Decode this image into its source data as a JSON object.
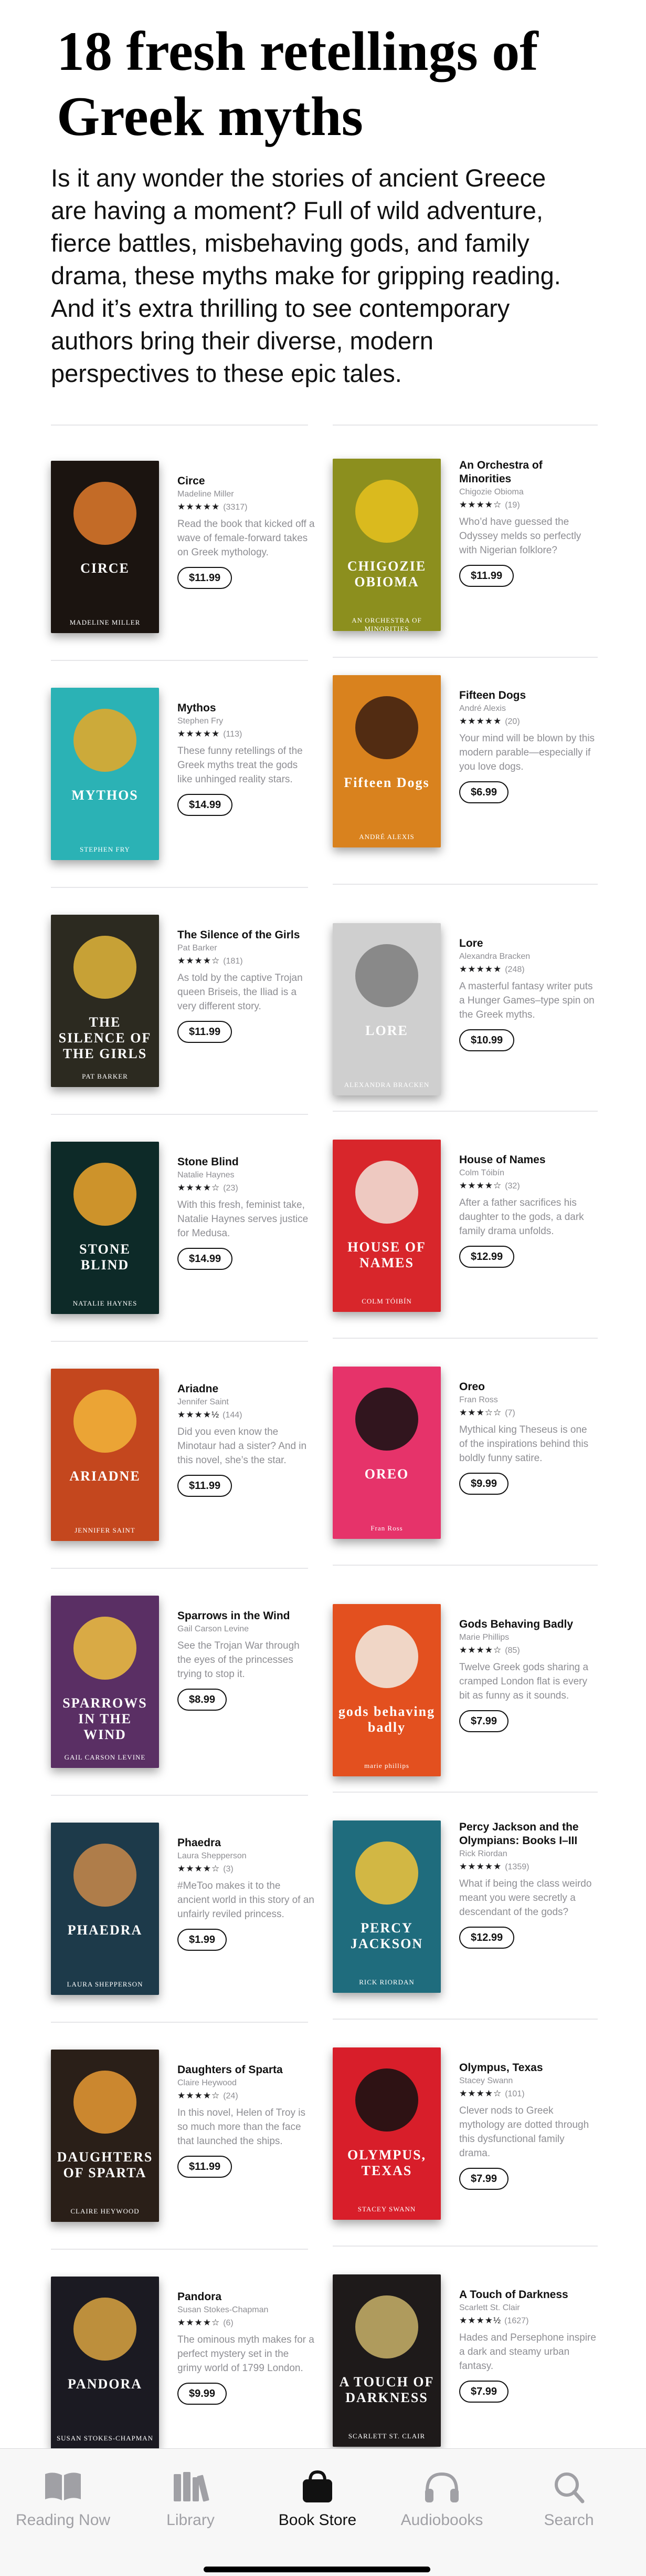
{
  "title": "18 fresh retellings of Greek myths",
  "intro": "Is it any wonder the stories of ancient Greece are having a moment? Full of wild adventure, fierce battles, misbehaving gods, and family drama, these myths make for gripping reading. And it’s extra thrilling to see contemporary authors bring their diverse, modern perspectives to these epic tales.",
  "books": [
    {
      "title": "Circe",
      "author": "Madeline Miller",
      "stars": "★★★★★",
      "count": "(3317)",
      "desc": "Read the book that kicked off a wave of female-forward takes on Greek mythology.",
      "price": "$11.99",
      "cover": {
        "line1": "CIRCE",
        "line2": "MADELINE MILLER",
        "bg": "#1b1410",
        "accent": "#e07a2c"
      }
    },
    {
      "title": "An Orchestra of Minorities",
      "author": "Chigozie Obioma",
      "stars": "★★★★☆",
      "count": "(19)",
      "desc": "Who’d have guessed the Odyssey melds so perfectly with Nigerian folklore?",
      "price": "$11.99",
      "cover": {
        "line1": "CHIGOZIE OBIOMA",
        "line2": "AN ORCHESTRA OF MINORITIES",
        "bg": "#8c8f1e",
        "accent": "#e8c21e"
      }
    },
    {
      "title": "Mythos",
      "author": "Stephen Fry",
      "stars": "★★★★★",
      "count": "(113)",
      "desc": "These funny retellings of the Greek myths treat the gods like unhinged reality stars.",
      "price": "$14.99",
      "cover": {
        "line1": "MYTHOS",
        "line2": "STEPHEN FRY",
        "bg": "#2bb2b5",
        "accent": "#e9a825"
      }
    },
    {
      "title": "Fifteen Dogs",
      "author": "André Alexis",
      "stars": "★★★★★",
      "count": "(20)",
      "desc": "Your mind will be blown by this modern parable—especially if you love dogs.",
      "price": "$6.99",
      "cover": {
        "line1": "Fifteen Dogs",
        "line2": "ANDRÉ ALEXIS",
        "bg": "#d9821e",
        "accent": "#3a1d10"
      }
    },
    {
      "title": "The Silence of the Girls",
      "author": "Pat Barker",
      "stars": "★★★★☆",
      "count": "(181)",
      "desc": "As told by the captive Trojan queen Briseis, the Iliad is a very different story.",
      "price": "$11.99",
      "cover": {
        "line1": "THE SILENCE OF THE GIRLS",
        "line2": "PAT BARKER",
        "bg": "#2c2a20",
        "accent": "#e3b63b"
      }
    },
    {
      "title": "Lore",
      "author": "Alexandra Bracken",
      "stars": "★★★★★",
      "count": "(248)",
      "desc": "A masterful fantasy writer puts a Hunger Games–type spin on the Greek myths.",
      "price": "$10.99",
      "cover": {
        "line1": "LORE",
        "line2": "ALEXANDRA BRACKEN",
        "bg": "#cfcfcf",
        "accent": "#7d7d7d"
      }
    },
    {
      "title": "Stone Blind",
      "author": "Natalie Haynes",
      "stars": "★★★★☆",
      "count": "(23)",
      "desc": "With this fresh, feminist take, Natalie Haynes serves justice for Medusa.",
      "price": "$14.99",
      "cover": {
        "line1": "STONE BLIND",
        "line2": "NATALIE HAYNES",
        "bg": "#0d2a28",
        "accent": "#f0a62b"
      }
    },
    {
      "title": "House of Names",
      "author": "Colm Tóibín",
      "stars": "★★★★☆",
      "count": "(32)",
      "desc": "After a father sacrifices his daughter to the gods, a dark family drama unfolds.",
      "price": "$12.99",
      "cover": {
        "line1": "HOUSE OF NAMES",
        "line2": "COLM TÓIBÍN",
        "bg": "#d8262b",
        "accent": "#f2e6dc"
      }
    },
    {
      "title": "Ariadne",
      "author": "Jennifer Saint",
      "stars": "★★★★½",
      "count": "(144)",
      "desc": "Did you even know the Minotaur had a sister? And in this novel, she’s the star.",
      "price": "$11.99",
      "cover": {
        "line1": "ARIADNE",
        "line2": "JENNIFER SAINT",
        "bg": "#c4471e",
        "accent": "#f2b53a"
      }
    },
    {
      "title": "Oreo",
      "author": "Fran Ross",
      "stars": "★★★☆☆",
      "count": "(7)",
      "desc": "Mythical king Theseus is one of the inspirations behind this boldly funny satire.",
      "price": "$9.99",
      "cover": {
        "line1": "OREO",
        "line2": "Fran Ross",
        "bg": "#e6336a",
        "accent": "#111111"
      }
    },
    {
      "title": "Sparrows in the Wind",
      "author": "Gail Carson Levine",
      "stars": "",
      "count": "",
      "desc": "See the Trojan War through the eyes of the princesses trying to stop it.",
      "price": "$8.99",
      "cover": {
        "line1": "SPARROWS IN THE WIND",
        "line2": "GAIL CARSON LEVINE",
        "bg": "#5a2f64",
        "accent": "#f0c040"
      }
    },
    {
      "title": "Gods Behaving Badly",
      "author": "Marie Phillips",
      "stars": "★★★★☆",
      "count": "(85)",
      "desc": "Twelve Greek gods sharing a cramped London flat is every bit as funny as it sounds.",
      "price": "$7.99",
      "cover": {
        "line1": "gods behaving badly",
        "line2": "marie phillips",
        "bg": "#e3501f",
        "accent": "#f2ede4"
      }
    },
    {
      "title": "Phaedra",
      "author": "Laura Shepperson",
      "stars": "★★★★☆",
      "count": "(3)",
      "desc": "#MeToo makes it to the ancient world in this story of an unfairly reviled princess.",
      "price": "$1.99",
      "cover": {
        "line1": "PHAEDRA",
        "line2": "LAURA SHEPPERSON",
        "bg": "#1d3a4a",
        "accent": "#c9894a"
      }
    },
    {
      "title": "Percy Jackson and the Olympians: Books I–III",
      "author": "Rick Riordan",
      "stars": "★★★★★",
      "count": "(1359)",
      "desc": "What if being the class weirdo meant you were secretly a descendant of the gods?",
      "price": "$12.99",
      "cover": {
        "line1": "PERCY JACKSON",
        "line2": "RICK RIORDAN",
        "bg": "#1f6c7d",
        "accent": "#f2c43a"
      }
    },
    {
      "title": "Daughters of Sparta",
      "author": "Claire Heywood",
      "stars": "★★★★☆",
      "count": "(24)",
      "desc": "In this novel, Helen of Troy is so much more than the face that launched the ships.",
      "price": "$11.99",
      "cover": {
        "line1": "DAUGHTERS OF SPARTA",
        "line2": "CLAIRE HEYWOOD",
        "bg": "#2a1f18",
        "accent": "#e89a34"
      }
    },
    {
      "title": "Olympus, Texas",
      "author": "Stacey Swann",
      "stars": "★★★★☆",
      "count": "(101)",
      "desc": "Clever nods to Greek mythology are dotted through this dysfunctional family drama.",
      "price": "$7.99",
      "cover": {
        "line1": "OLYMPUS, TEXAS",
        "line2": "STACEY SWANN",
        "bg": "#d81e2a",
        "accent": "#111111"
      }
    },
    {
      "title": "Pandora",
      "author": "Susan Stokes-Chapman",
      "stars": "★★★★☆",
      "count": "(6)",
      "desc": "The ominous myth makes for a perfect mystery set in the grimy world of 1799 London.",
      "price": "$9.99",
      "cover": {
        "line1": "PANDORA",
        "line2": "SUSAN STOKES-CHAPMAN",
        "bg": "#1b1a22",
        "accent": "#d9a441"
      }
    },
    {
      "title": "A Touch of Darkness",
      "author": "Scarlett St. Clair",
      "stars": "★★★★½",
      "count": "(1627)",
      "desc": "Hades and Persephone inspire a dark and steamy urban fantasy.",
      "price": "$7.99",
      "cover": {
        "line1": "A TOUCH OF DARKNESS",
        "line2": "SCARLETT ST. CLAIR",
        "bg": "#1e1a1a",
        "accent": "#c9b36a"
      }
    }
  ],
  "tabs": [
    {
      "label": "Reading Now",
      "icon": "book-open-icon"
    },
    {
      "label": "Library",
      "icon": "library-icon"
    },
    {
      "label": "Book Store",
      "icon": "shopping-bag-icon"
    },
    {
      "label": "Audiobooks",
      "icon": "headphones-icon"
    },
    {
      "label": "Search",
      "icon": "search-icon"
    }
  ],
  "colors": {
    "accent": "#111111",
    "muted": "#8e8e93",
    "tab_inactive": "#a0a0a5"
  }
}
